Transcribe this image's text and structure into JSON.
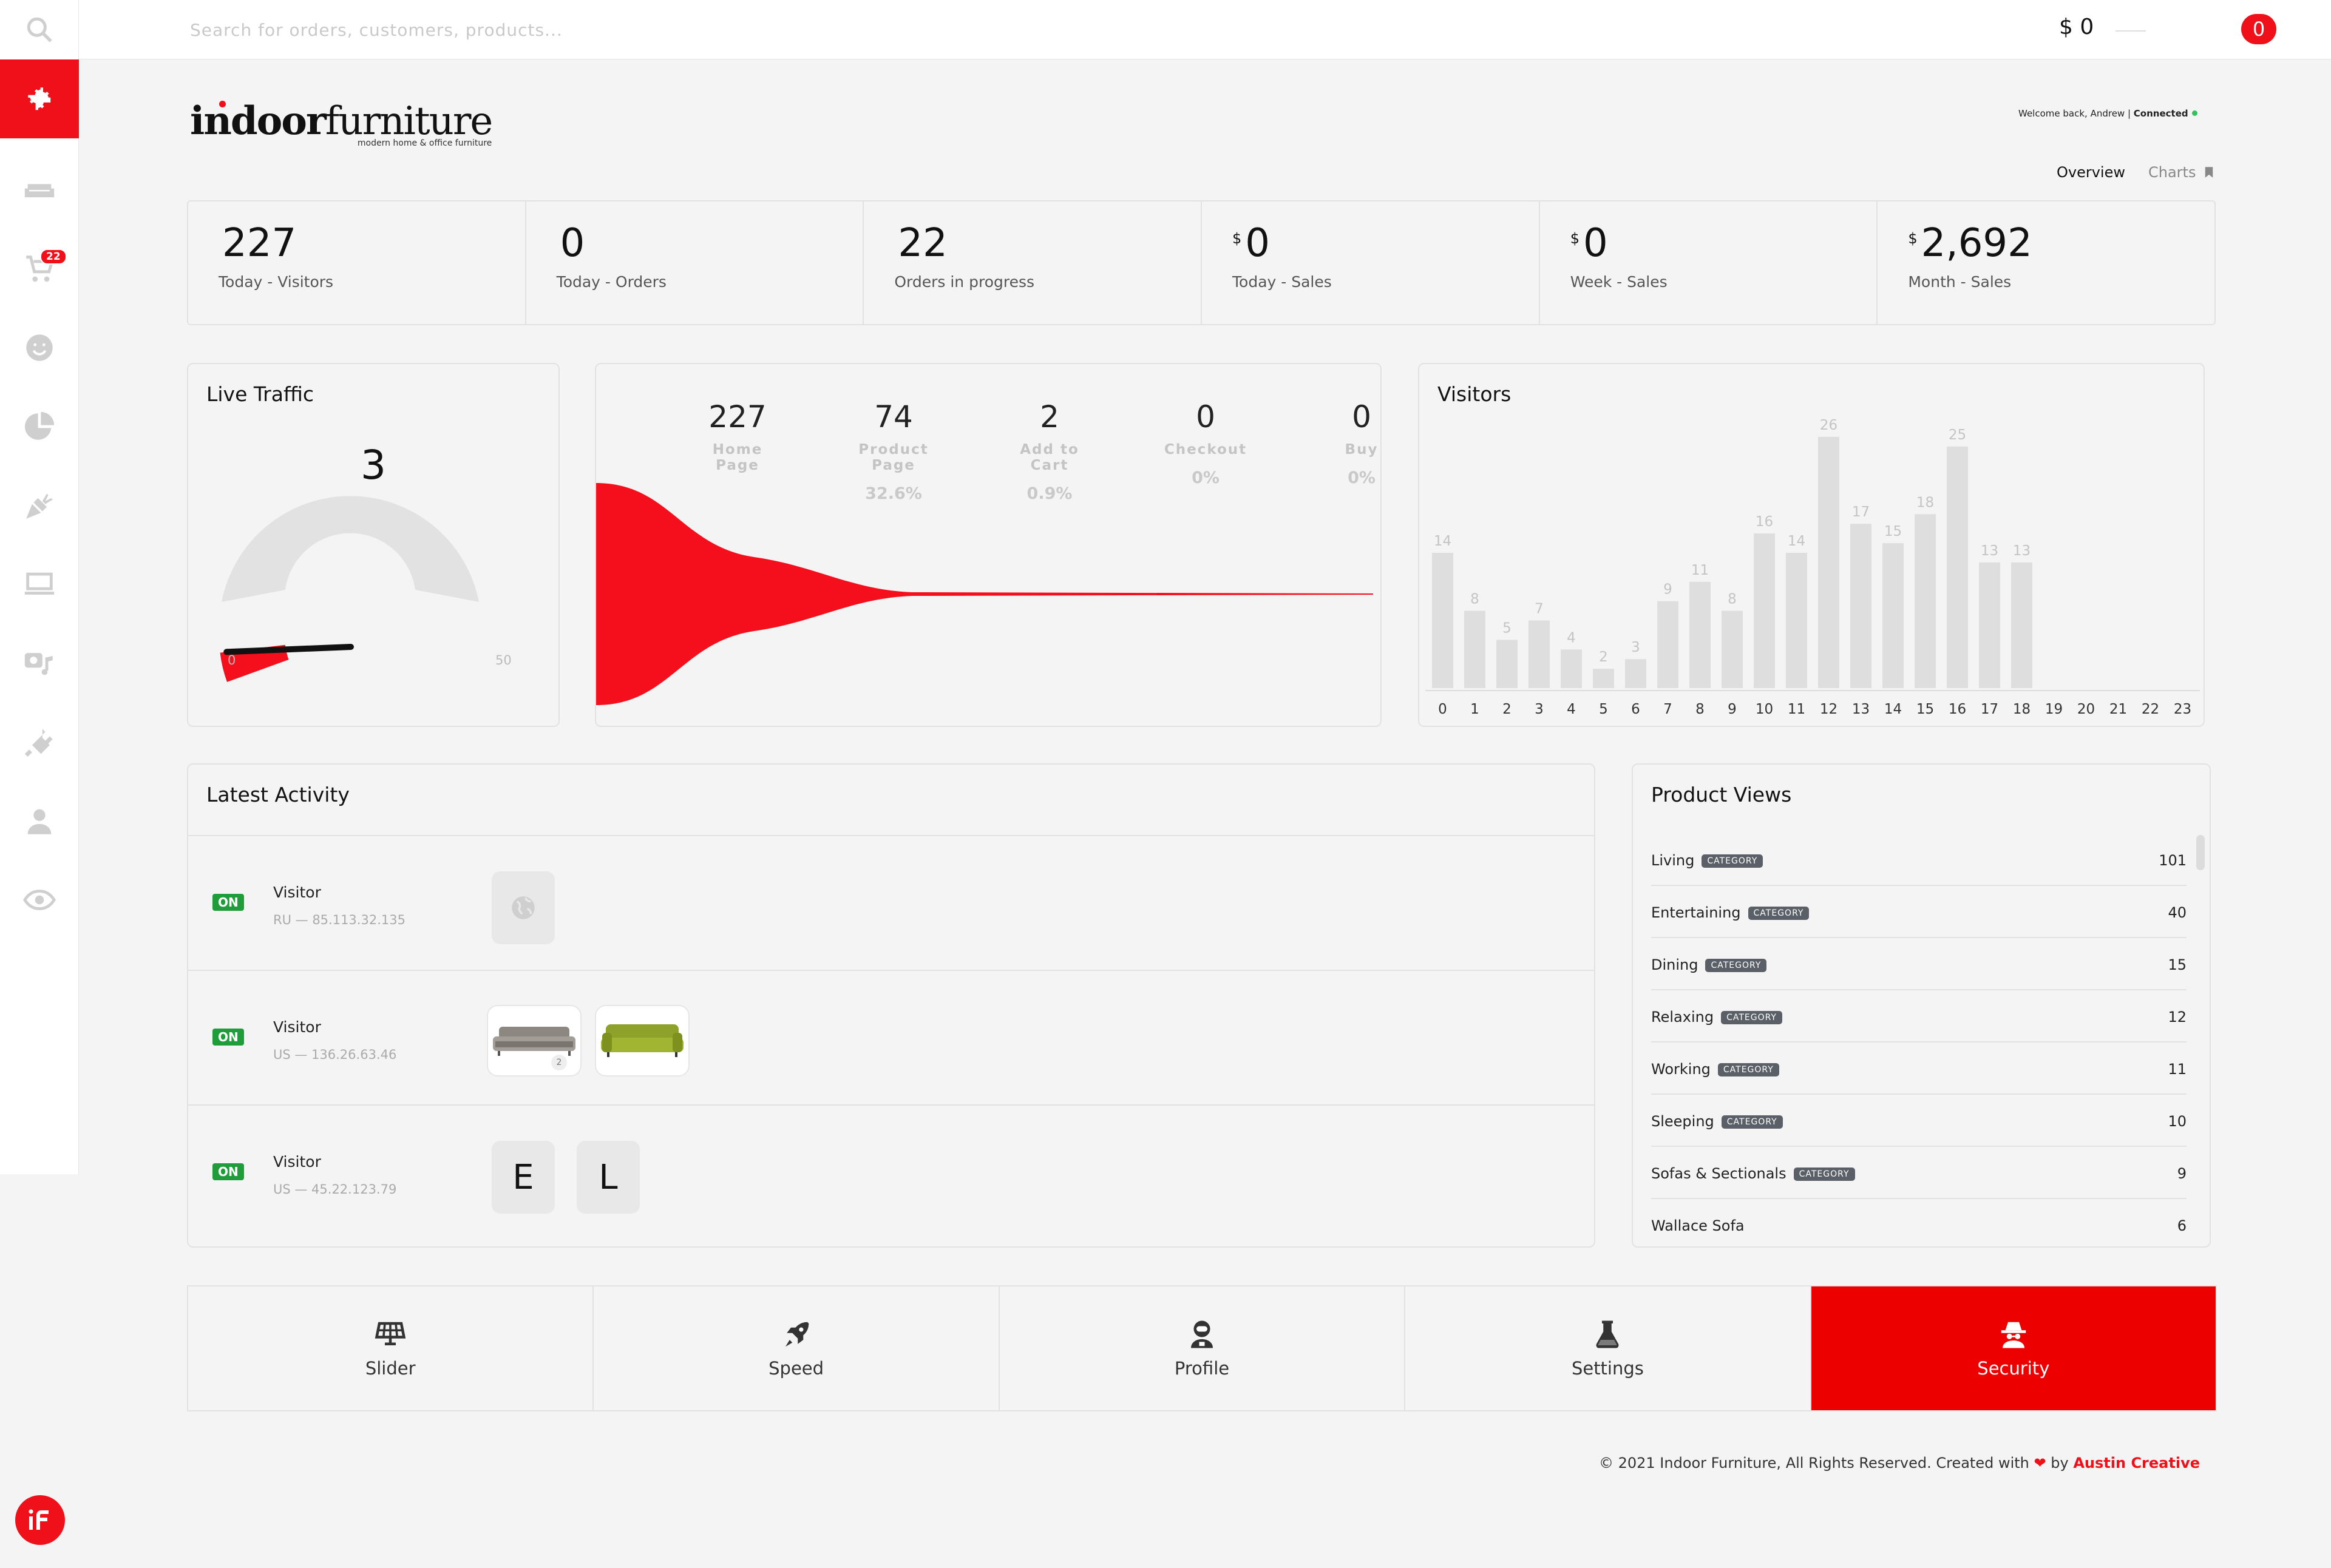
{
  "topbar": {
    "search_placeholder": "Search for orders, customers, products...",
    "cart_amount": "$ 0",
    "cart_count": "0"
  },
  "sidebar": {
    "items": [
      {
        "name": "dashboard",
        "icon": "gear-icon"
      },
      {
        "name": "products",
        "icon": "sofa-icon"
      },
      {
        "name": "orders",
        "icon": "cart-icon",
        "badge": "22"
      },
      {
        "name": "customers",
        "icon": "smiley-icon"
      },
      {
        "name": "reports",
        "icon": "pie-chart-icon"
      },
      {
        "name": "marketing",
        "icon": "carrot-icon"
      },
      {
        "name": "website",
        "icon": "laptop-icon"
      },
      {
        "name": "media",
        "icon": "camera-music-icon"
      },
      {
        "name": "plugins",
        "icon": "plug-icon"
      },
      {
        "name": "users",
        "icon": "user-icon"
      },
      {
        "name": "settings",
        "icon": "eye-icon"
      }
    ],
    "active_color": "#ef1019"
  },
  "header": {
    "brand_bold": "indoor",
    "brand_light": "furniture",
    "brand_tagline": "modern home & office furniture",
    "welcome": "Welcome back, Andrew |",
    "status": "Connected",
    "tabs": [
      "Overview",
      "Charts"
    ]
  },
  "stats": [
    {
      "currency": "",
      "value": "227",
      "label": "Today - Visitors"
    },
    {
      "currency": "",
      "value": "0",
      "label": "Today - Orders"
    },
    {
      "currency": "",
      "value": "22",
      "label": "Orders in progress"
    },
    {
      "currency": "$",
      "value": "0",
      "label": "Today - Sales"
    },
    {
      "currency": "$",
      "value": "0",
      "label": "Week - Sales"
    },
    {
      "currency": "$",
      "value": "2,692",
      "label": "Month - Sales"
    }
  ],
  "live_traffic": {
    "title": "Live Traffic",
    "value": "3",
    "min": "0",
    "max": "50",
    "gauge_value": 3
  },
  "funnel": {
    "steps": [
      {
        "value": "227",
        "label": "Home Page",
        "pct": ""
      },
      {
        "value": "74",
        "label": "Product Page",
        "pct": "32.6%"
      },
      {
        "value": "2",
        "label": "Add to Cart",
        "pct": "0.9%"
      },
      {
        "value": "0",
        "label": "Checkout",
        "pct": "0%"
      },
      {
        "value": "0",
        "label": "Buy",
        "pct": "0%"
      }
    ],
    "color": "#f50f1c"
  },
  "chart_data": {
    "type": "bar",
    "title": "Visitors",
    "categories": [
      "0",
      "1",
      "2",
      "3",
      "4",
      "5",
      "6",
      "7",
      "8",
      "9",
      "10",
      "11",
      "12",
      "13",
      "14",
      "15",
      "16",
      "17",
      "18",
      "19",
      "20",
      "21",
      "22",
      "23"
    ],
    "values": [
      14,
      8,
      5,
      7,
      4,
      2,
      3,
      9,
      11,
      8,
      16,
      14,
      26,
      17,
      15,
      18,
      25,
      13,
      13,
      null,
      null,
      null,
      null,
      null
    ],
    "ylim": [
      0,
      28
    ],
    "grid": false,
    "bar_color": "#dedede"
  },
  "activity": {
    "title": "Latest Activity",
    "rows": [
      {
        "status": "ON",
        "name": "Visitor",
        "ip": "RU — 85.113.32.135",
        "items": [
          "globe-icon"
        ]
      },
      {
        "status": "ON",
        "name": "Visitor",
        "ip": "US — 136.26.63.46",
        "items": [
          "grey-sofa",
          "green-sofa"
        ],
        "qty": "2"
      },
      {
        "status": "ON",
        "name": "Visitor",
        "ip": "US — 45.22.123.79",
        "items": [
          "E",
          "L"
        ]
      }
    ]
  },
  "product_views": {
    "title": "Product Views",
    "rows": [
      {
        "name": "Living",
        "tag": "CATEGORY",
        "count": "101"
      },
      {
        "name": "Entertaining",
        "tag": "CATEGORY",
        "count": "40"
      },
      {
        "name": "Dining",
        "tag": "CATEGORY",
        "count": "15"
      },
      {
        "name": "Relaxing",
        "tag": "CATEGORY",
        "count": "12"
      },
      {
        "name": "Working",
        "tag": "CATEGORY",
        "count": "11"
      },
      {
        "name": "Sleeping",
        "tag": "CATEGORY",
        "count": "10"
      },
      {
        "name": "Sofas & Sectionals",
        "tag": "CATEGORY",
        "count": "9"
      },
      {
        "name": "Wallace Sofa",
        "tag": "",
        "count": "6"
      }
    ]
  },
  "shortcuts": [
    {
      "label": "Slider",
      "icon": "solar-panel-icon"
    },
    {
      "label": "Speed",
      "icon": "rocket-icon"
    },
    {
      "label": "Profile",
      "icon": "user-astronaut-icon"
    },
    {
      "label": "Settings",
      "icon": "flask-icon"
    },
    {
      "label": "Security",
      "icon": "spy-icon",
      "active": true
    }
  ],
  "footer": {
    "text": "© 2021 Indoor Furniture, All Rights Reserved. Created with",
    "heart": "❤",
    "by": "by",
    "author": "Austin Creative"
  }
}
